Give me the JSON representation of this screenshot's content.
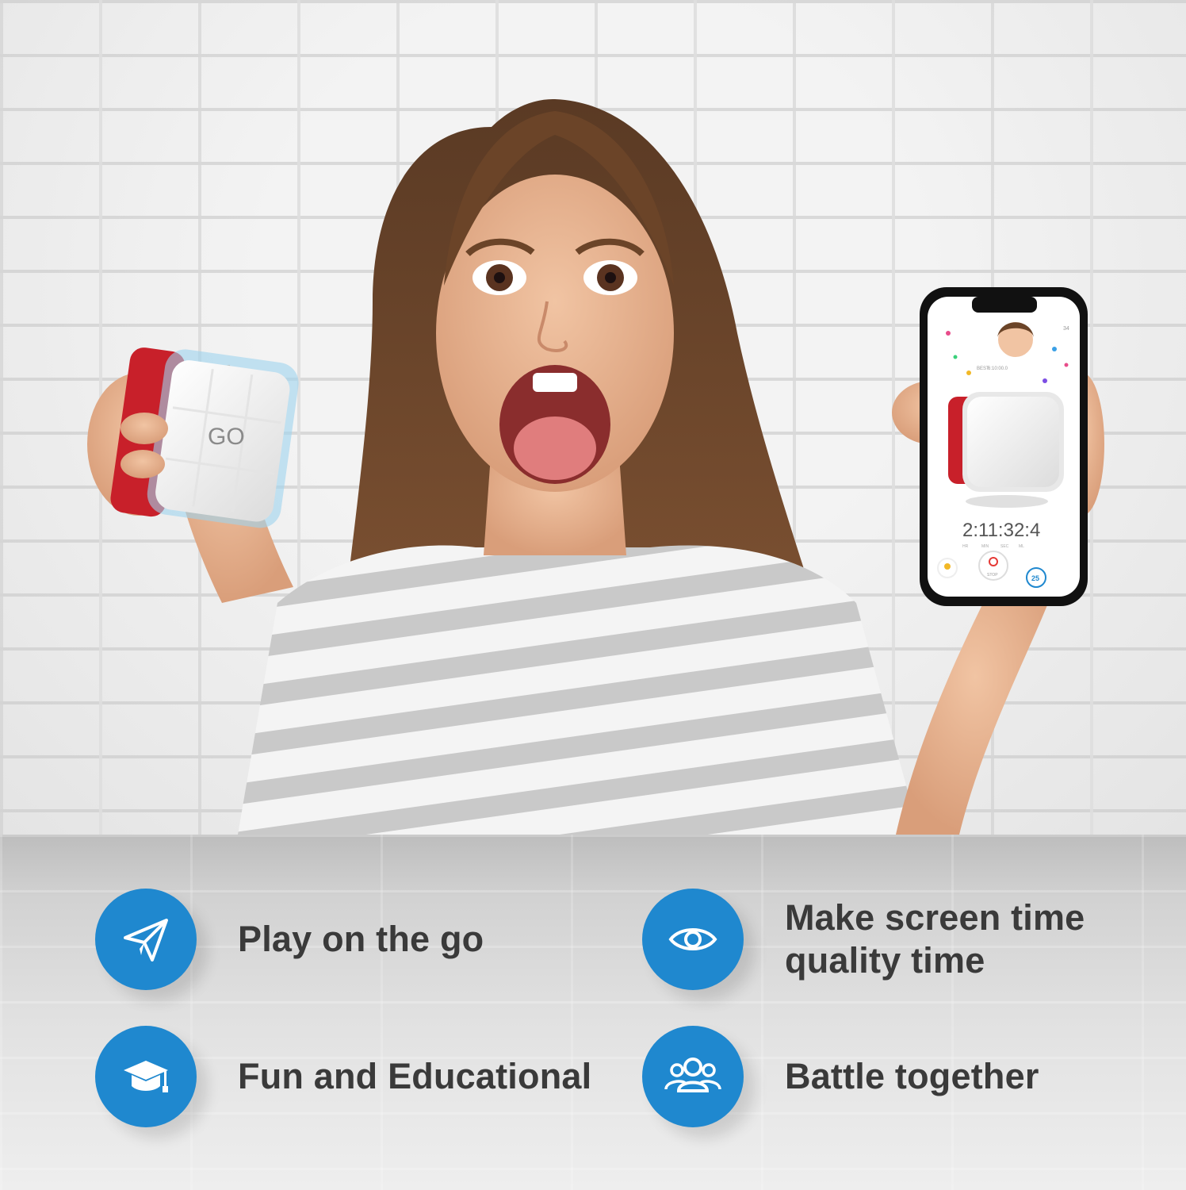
{
  "cube_logo": "GO",
  "phone": {
    "best_label": "BEST",
    "best_time": "6:10:00.0",
    "counter": "34",
    "timer": "2:11:32:4",
    "timer_units": [
      "HR",
      "MIN",
      "SEC",
      "ML"
    ],
    "stop_label": "STOP",
    "badge_number": "25"
  },
  "features": [
    {
      "label": "Play on the go",
      "icon": "paper-plane-icon"
    },
    {
      "label_line1": "Make screen time",
      "label_line2": "quality time",
      "icon": "eye-icon"
    },
    {
      "label": "Fun and Educational",
      "icon": "graduation-cap-icon"
    },
    {
      "label": "Battle together",
      "icon": "group-icon"
    }
  ],
  "colors": {
    "accent_blue": "#1f88cf",
    "text_dark": "#3a3a3a",
    "cube_red": "#c8202a"
  }
}
